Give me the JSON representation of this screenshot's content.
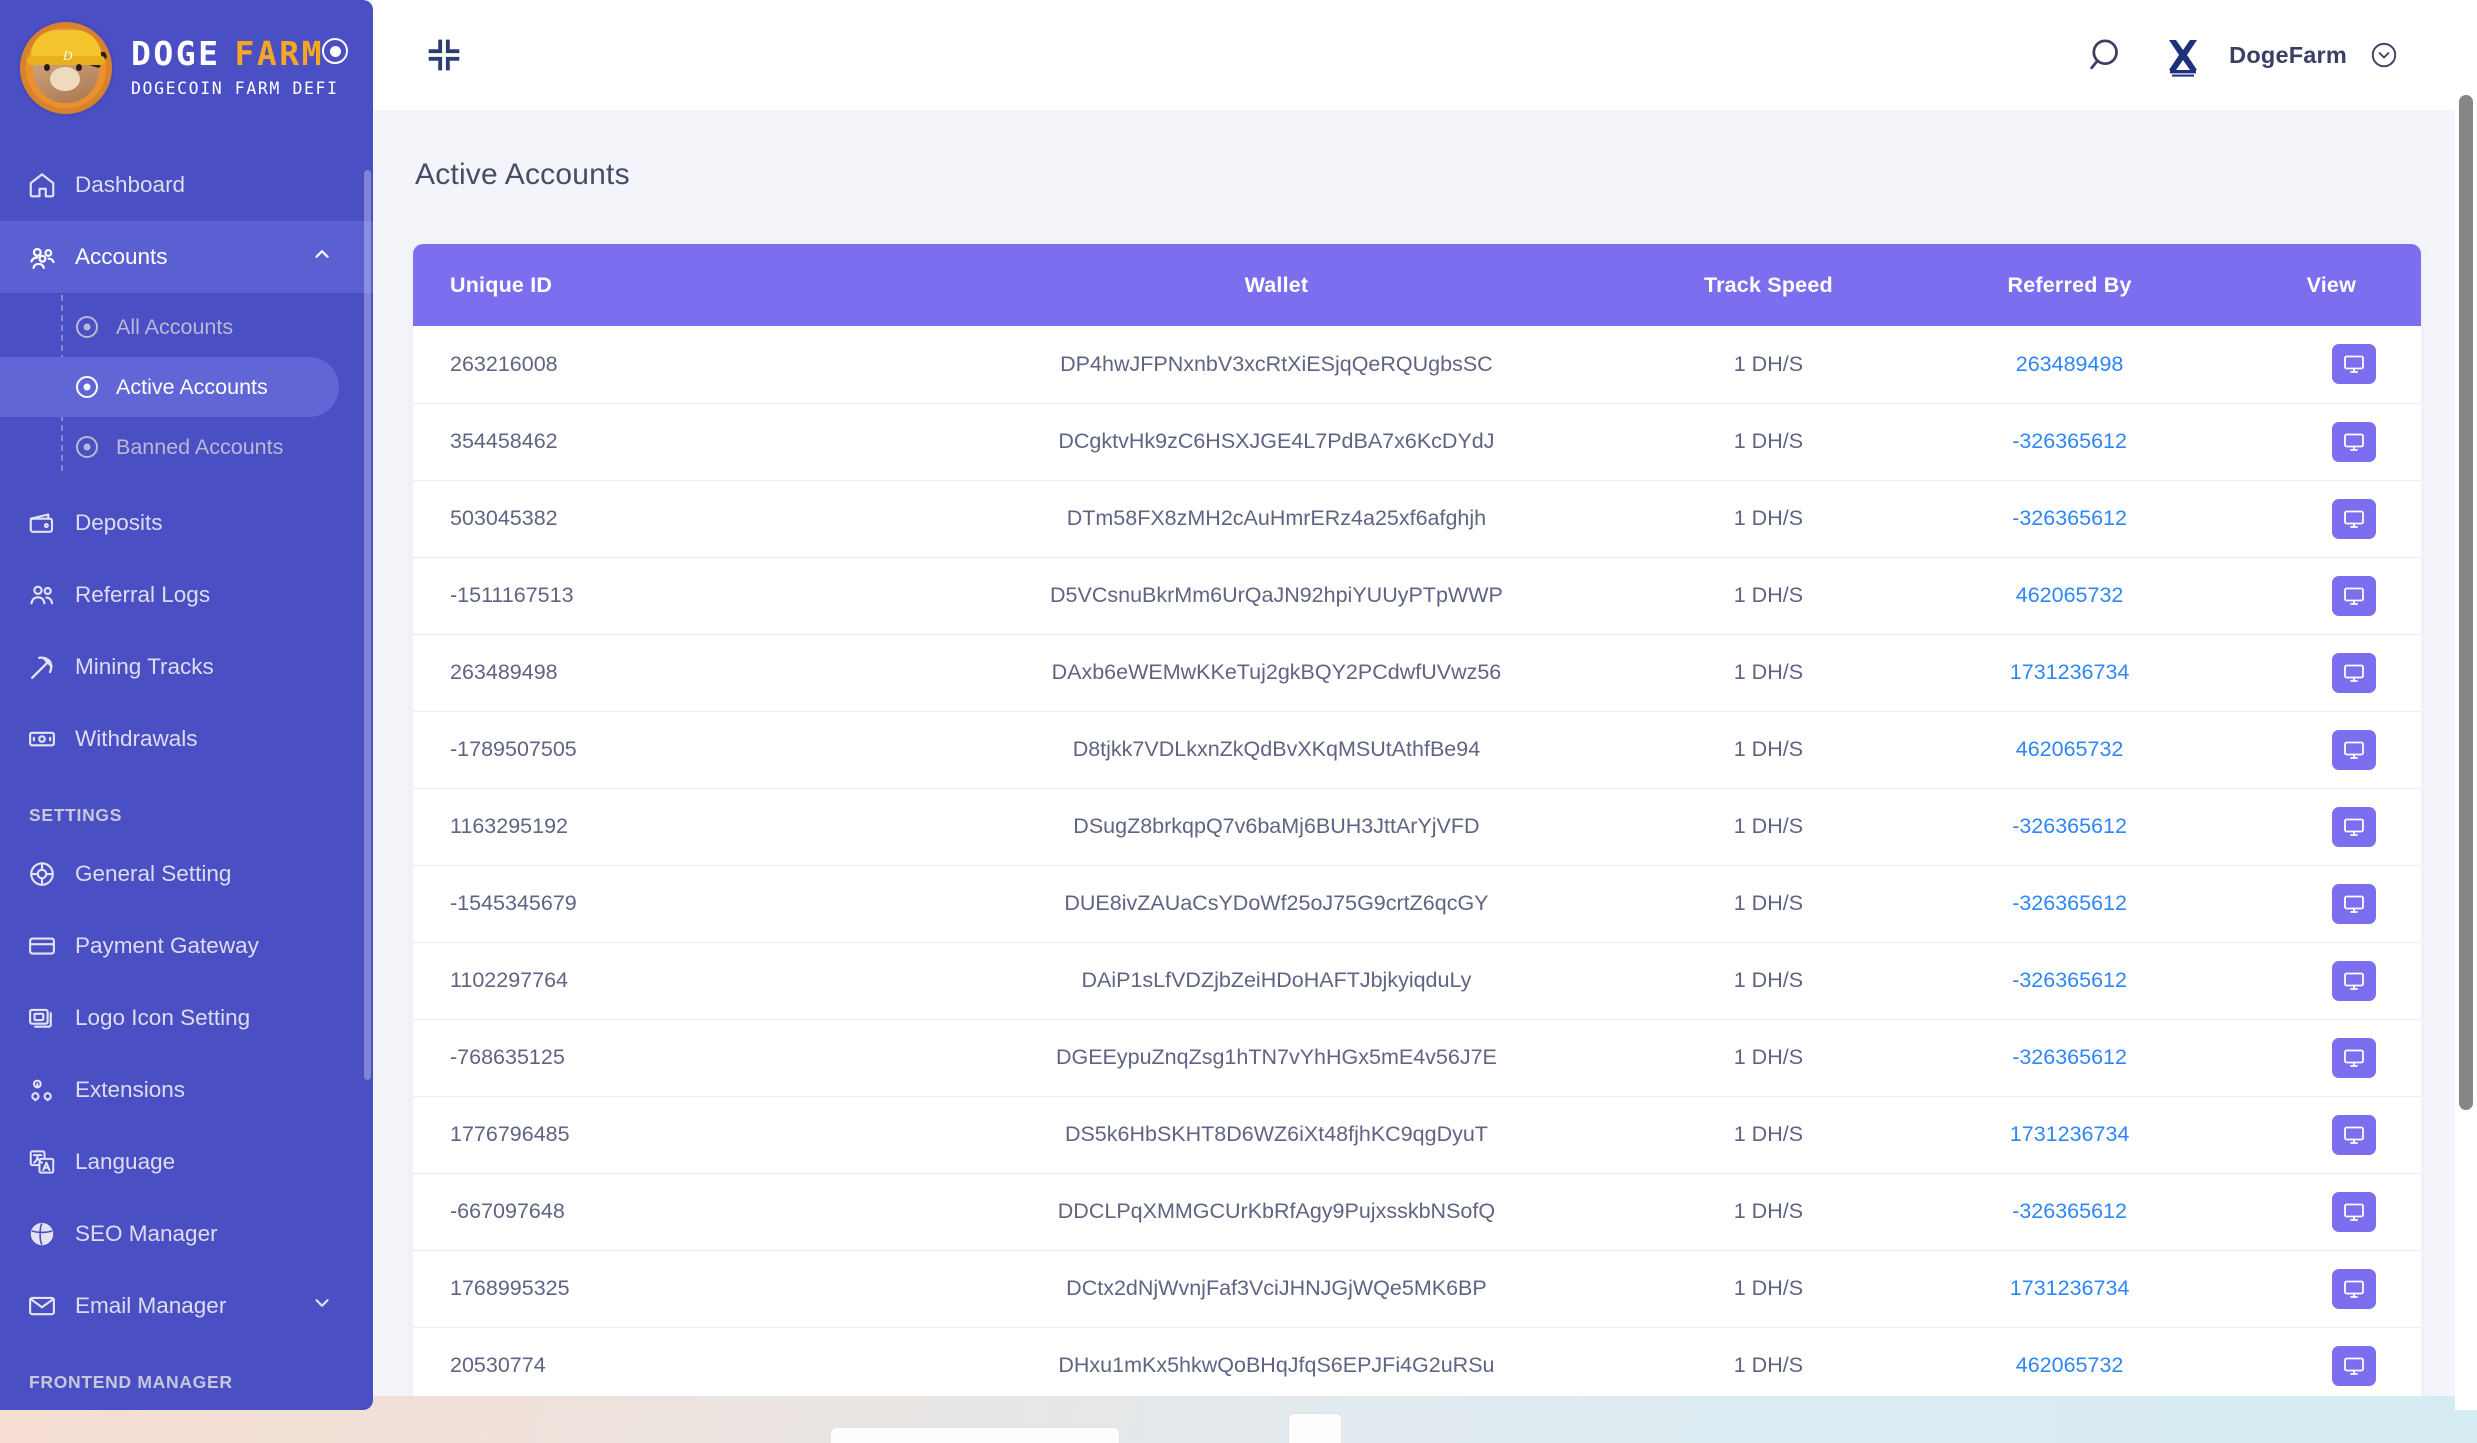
{
  "brand": {
    "title_word1": "DOGE",
    "title_word2": "FARM",
    "subtitle": "DOGECOIN FARM DEFI",
    "logo_mark": "D",
    "toggle_icon": "radio-pinned-icon",
    "accent_color": "#f5a623",
    "sidebar_color": "#4b4fc4"
  },
  "sidebar": {
    "items": [
      {
        "label": "Dashboard",
        "icon": "home-icon",
        "state": "normal"
      },
      {
        "label": "Accounts",
        "icon": "users-group-icon",
        "state": "expanded",
        "chevron": "chevron-up-icon"
      },
      {
        "label": "Deposits",
        "icon": "wallet-icon",
        "state": "normal"
      },
      {
        "label": "Referral Logs",
        "icon": "people-icon",
        "state": "normal"
      },
      {
        "label": "Mining Tracks",
        "icon": "pickaxe-icon",
        "state": "normal"
      },
      {
        "label": "Withdrawals",
        "icon": "banknote-icon",
        "state": "normal"
      }
    ],
    "accounts_submenu": [
      {
        "label": "All Accounts",
        "icon": "radio-dot-icon",
        "active": false
      },
      {
        "label": "Active Accounts",
        "icon": "radio-dot-icon",
        "active": true
      },
      {
        "label": "Banned Accounts",
        "icon": "radio-dot-icon",
        "active": false
      }
    ],
    "settings_heading": "SETTINGS",
    "settings_items": [
      {
        "label": "General Setting",
        "icon": "gear-wheel-icon"
      },
      {
        "label": "Payment Gateway",
        "icon": "credit-card-icon"
      },
      {
        "label": "Logo Icon Setting",
        "icon": "stacked-images-icon"
      },
      {
        "label": "Extensions",
        "icon": "extensions-gears-icon"
      },
      {
        "label": "Language",
        "icon": "translate-icon"
      },
      {
        "label": "SEO Manager",
        "icon": "globe-icon"
      },
      {
        "label": "Email Manager",
        "icon": "envelope-icon",
        "chevron": "chevron-down-icon"
      }
    ],
    "frontend_heading": "FRONTEND MANAGER"
  },
  "topbar": {
    "collapse_icon": "collapse-corners-icon",
    "search_icon": "search-icon",
    "avatar_icon": "user-brand-logo",
    "user_name": "DogeFarm",
    "user_chevron_icon": "chevron-down-circle-icon"
  },
  "page": {
    "title": "Active Accounts"
  },
  "table": {
    "columns": [
      "Unique ID",
      "Wallet",
      "Track Speed",
      "Referred By",
      "View"
    ],
    "view_button_icon": "monitor-icon",
    "view_button_color": "#7b6ff0",
    "header_color": "#7b6ff0",
    "link_color": "#2e86f7",
    "rows": [
      {
        "unique_id": "263216008",
        "wallet": "DP4hwJFPNxnbV3xcRtXiESjqQeRQUgbsSC",
        "track_speed": "1 DH/S",
        "referred_by": "263489498"
      },
      {
        "unique_id": "354458462",
        "wallet": "DCgktvHk9zC6HSXJGE4L7PdBA7x6KcDYdJ",
        "track_speed": "1 DH/S",
        "referred_by": "-326365612"
      },
      {
        "unique_id": "503045382",
        "wallet": "DTm58FX8zMH2cAuHmrERz4a25xf6afghjh",
        "track_speed": "1 DH/S",
        "referred_by": "-326365612"
      },
      {
        "unique_id": "-1511167513",
        "wallet": "D5VCsnuBkrMm6UrQaJN92hpiYUUyPTpWWP",
        "track_speed": "1 DH/S",
        "referred_by": "462065732"
      },
      {
        "unique_id": "263489498",
        "wallet": "DAxb6eWEMwKKeTuj2gkBQY2PCdwfUVwz56",
        "track_speed": "1 DH/S",
        "referred_by": "1731236734"
      },
      {
        "unique_id": "-1789507505",
        "wallet": "D8tjkk7VDLkxnZkQdBvXKqMSUtAthfBe94",
        "track_speed": "1 DH/S",
        "referred_by": "462065732"
      },
      {
        "unique_id": "1163295192",
        "wallet": "DSugZ8brkqpQ7v6baMj6BUH3JttArYjVFD",
        "track_speed": "1 DH/S",
        "referred_by": "-326365612"
      },
      {
        "unique_id": "-1545345679",
        "wallet": "DUE8ivZAUaCsYDoWf25oJ75G9crtZ6qcGY",
        "track_speed": "1 DH/S",
        "referred_by": "-326365612"
      },
      {
        "unique_id": "1102297764",
        "wallet": "DAiP1sLfVDZjbZeiHDoHAFTJbjkyiqduLy",
        "track_speed": "1 DH/S",
        "referred_by": "-326365612"
      },
      {
        "unique_id": "-768635125",
        "wallet": "DGEEypuZnqZsg1hTN7vYhHGx5mE4v56J7E",
        "track_speed": "1 DH/S",
        "referred_by": "-326365612"
      },
      {
        "unique_id": "1776796485",
        "wallet": "DS5k6HbSKHT8D6WZ6iXt48fjhKC9qgDyuT",
        "track_speed": "1 DH/S",
        "referred_by": "1731236734"
      },
      {
        "unique_id": "-667097648",
        "wallet": "DDCLPqXMMGCUrKbRfAgy9PujxsskbNSofQ",
        "track_speed": "1 DH/S",
        "referred_by": "-326365612"
      },
      {
        "unique_id": "1768995325",
        "wallet": "DCtx2dNjWvnjFaf3VciJHNJGjWQe5MK6BP",
        "track_speed": "1 DH/S",
        "referred_by": "1731236734"
      },
      {
        "unique_id": "20530774",
        "wallet": "DHxu1mKx5hkwQoBHqJfqS6EPJFi4G2uRSu",
        "track_speed": "1 DH/S",
        "referred_by": "462065732"
      }
    ]
  }
}
